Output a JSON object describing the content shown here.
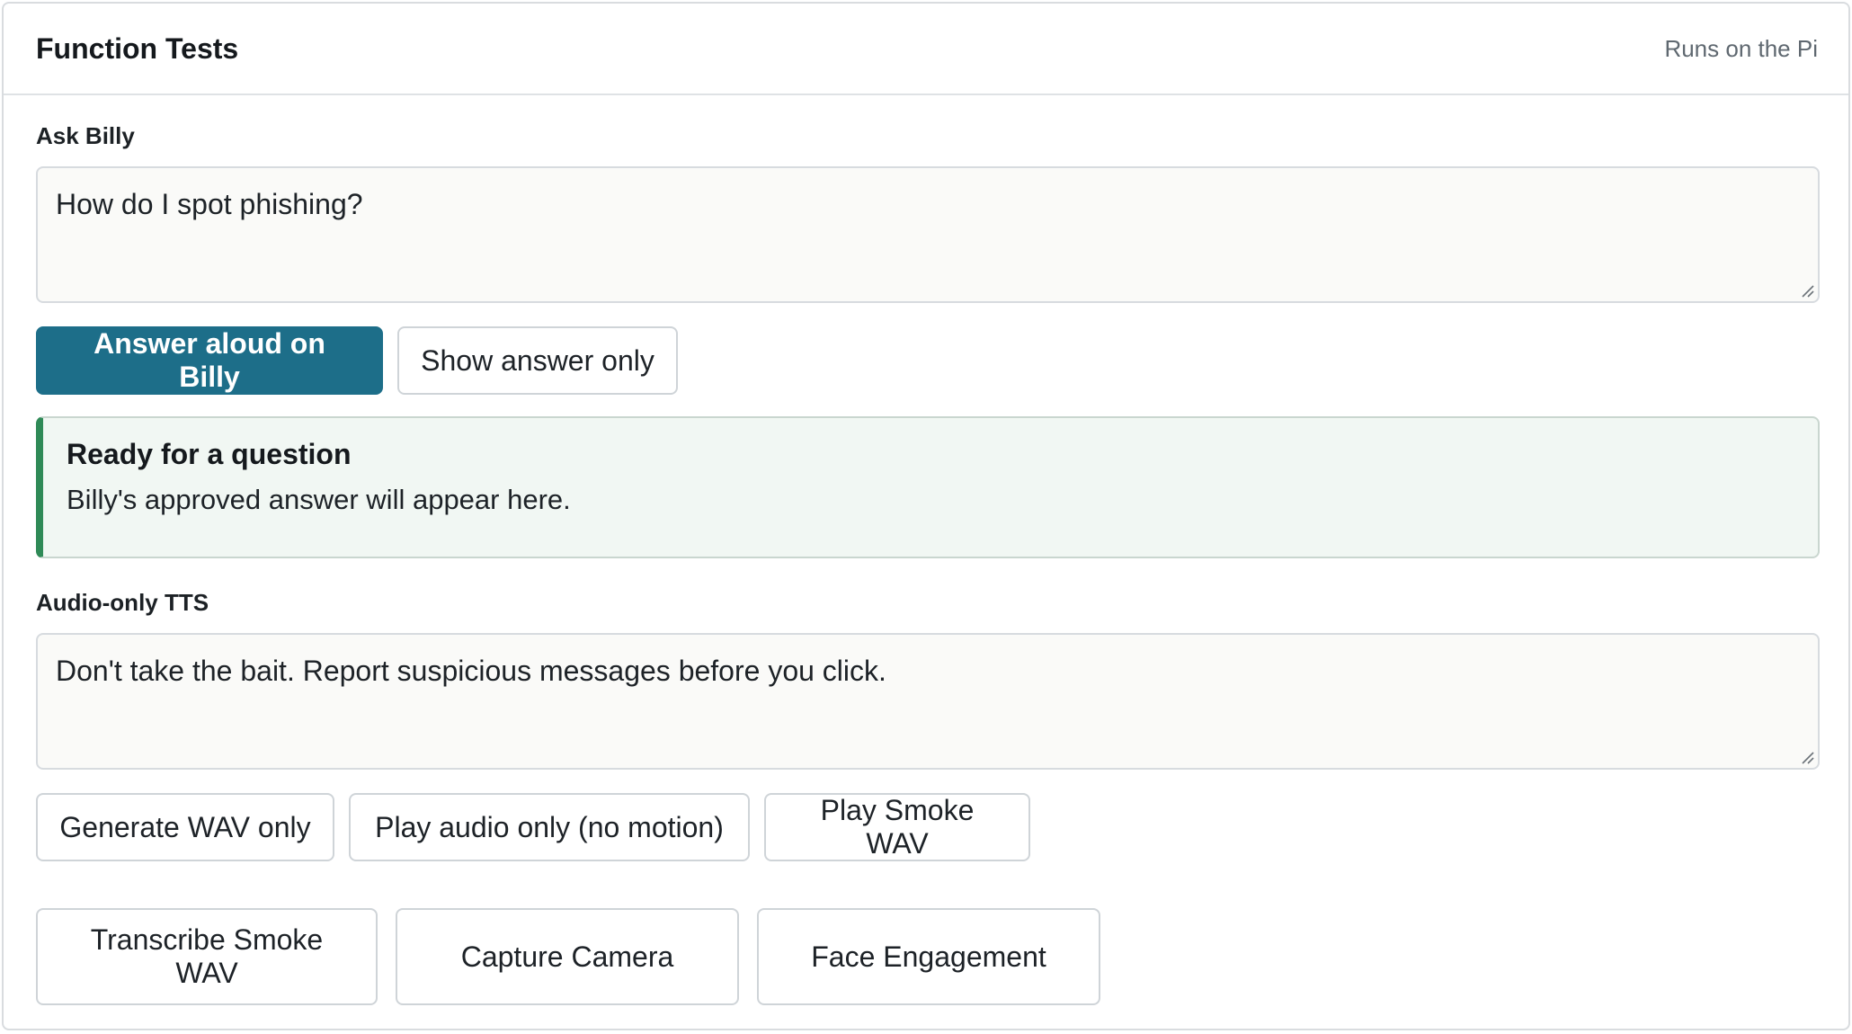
{
  "card": {
    "title": "Function Tests",
    "note": "Runs on the Pi"
  },
  "ask": {
    "label": "Ask Billy",
    "value": "How do I spot phishing?",
    "buttons": {
      "primary": "Answer aloud on Billy",
      "secondary": "Show answer only"
    },
    "status": {
      "title": "Ready for a question",
      "text": "Billy's approved answer will appear here."
    }
  },
  "tts": {
    "label": "Audio-only TTS",
    "value": "Don't take the bait. Report suspicious messages before you click.",
    "buttons": {
      "generate": "Generate WAV only",
      "play_audio": "Play audio only (no motion)",
      "play_smoke": "Play Smoke WAV"
    }
  },
  "tools": {
    "transcribe": "Transcribe Smoke WAV",
    "capture": "Capture Camera",
    "face": "Face Engagement"
  },
  "colors": {
    "primary_button": "#1d6e89",
    "status_accent": "#2f8a57",
    "status_bg": "#f1f7f3"
  },
  "icons": {
    "resize_grip": "resize-grip-icon"
  }
}
